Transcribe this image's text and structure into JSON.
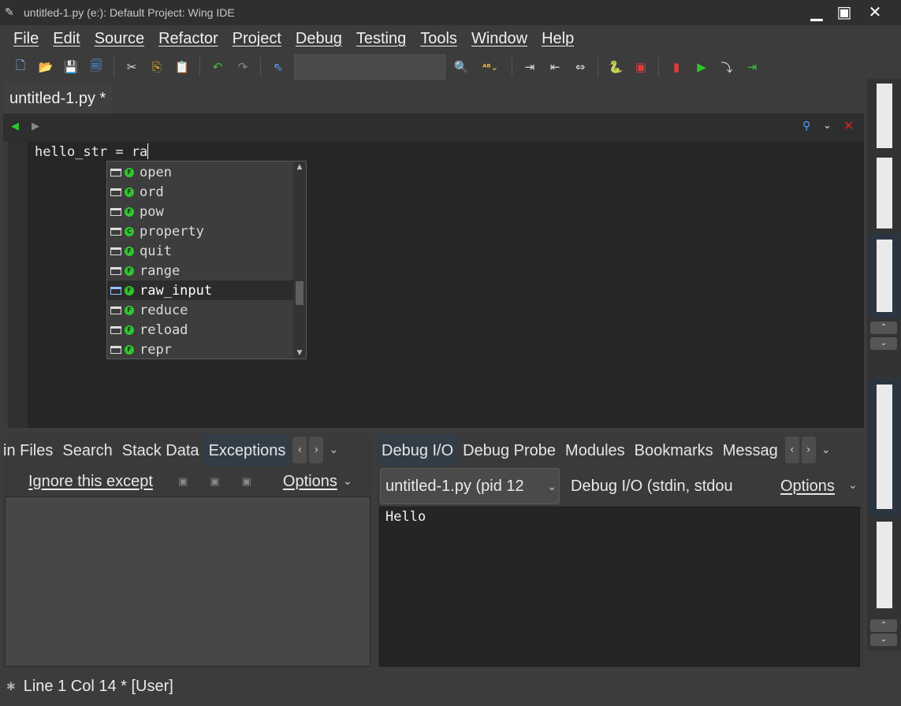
{
  "window": {
    "title": "untitled-1.py (e:): Default Project: Wing IDE",
    "app_icon": "feather-icon"
  },
  "menubar": [
    "File",
    "Edit",
    "Source",
    "Refactor",
    "Project",
    "Debug",
    "Testing",
    "Tools",
    "Window",
    "Help"
  ],
  "toolbar": {
    "search_value": ""
  },
  "editor": {
    "tab_label": "untitled-1.py *",
    "code_line": "hello_str = ra"
  },
  "autocomplete": {
    "items": [
      "open",
      "ord",
      "pow",
      "property",
      "quit",
      "range",
      "raw_input",
      "reduce",
      "reload",
      "repr"
    ],
    "item_types": [
      "F",
      "F",
      "F",
      "C",
      "F",
      "F",
      "F",
      "F",
      "F",
      "F"
    ],
    "selected": "raw_input"
  },
  "left_pane": {
    "tabs": [
      "in Files",
      "Search",
      "Stack Data",
      "Exceptions"
    ],
    "active_tab": "Exceptions",
    "ignore_label": "Ignore this except",
    "options_label": "Options"
  },
  "right_pane": {
    "tabs": [
      "Debug I/O",
      "Debug Probe",
      "Modules",
      "Bookmarks",
      "Messag"
    ],
    "active_tab": "Debug I/O",
    "process_select": "untitled-1.py (pid 12",
    "io_label": "Debug I/O (stdin, stdou",
    "options_label": "Options",
    "output": "Hello"
  },
  "statusbar": {
    "text": "Line 1 Col 14 * [User]"
  },
  "colors": {
    "accent": "#333d48",
    "completion_icon": "#2ec62e",
    "editor_bg": "#262626"
  }
}
